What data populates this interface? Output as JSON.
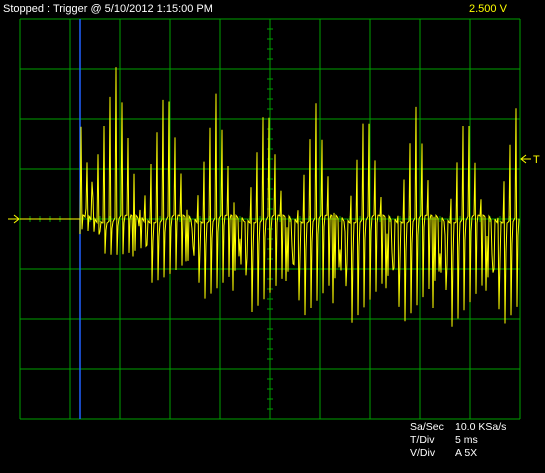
{
  "header": {
    "status": "Stopped : Trigger @ 5/10/2012 1:15:00 PM",
    "volts_per_div": "2.500  V"
  },
  "markers": {
    "trigger_level_label": "T"
  },
  "settings": {
    "sample_rate_label": "Sa/Sec",
    "sample_rate_value": "10.0 KSa/s",
    "time_div_label": "T/Div",
    "time_div_value": "5 ms",
    "volt_div_label": "V/Div",
    "volt_div_value": "A 5X"
  },
  "colors": {
    "background": "#000000",
    "grid": "#00a000",
    "trace": "#ffff00",
    "cursor": "#2060ff",
    "text": "#ffffff"
  },
  "chart_data": {
    "type": "line",
    "grid": true,
    "grid_divisions": {
      "x": 10,
      "y": 8
    },
    "timebase_ms_per_div": 5,
    "trigger_position_div": 1.2,
    "signal": {
      "description_of_shape": "flat baseline before trigger, then oscillation with decaying envelope settling to steady amplitude",
      "pre_trigger_level_div": 0.0,
      "settled_center_div": 0.0,
      "initial_peak_div": 3.4,
      "initial_trough_div": -0.3,
      "settled_peak_div": 2.2,
      "settled_trough_div": -2.2,
      "cycles_per_div": 8.5
    }
  }
}
